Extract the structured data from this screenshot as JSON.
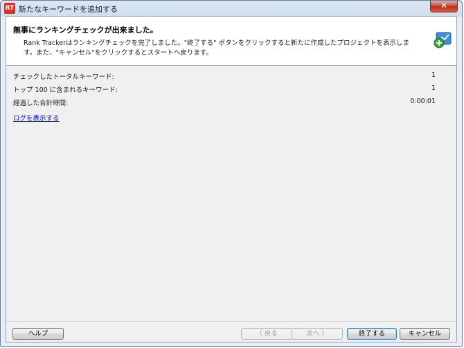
{
  "window": {
    "title": "新たなキーワードを追加する",
    "app_icon_text": "RT",
    "close_glyph": "✕"
  },
  "header": {
    "title": "無事にランキングチェックが出来ました。",
    "description": "Rank Trackerはランキングチェックを完了しました。\"終了する\" ボタンをクリックすると新たに作成したプロジェクトを表示します。また、\"キャンセル\"をクリックするとスタートへ戻ります。",
    "icon": "add-keyword-wizard-icon"
  },
  "stats": [
    {
      "label": "チェックしたトータルキーワード:",
      "value": "1"
    },
    {
      "label": "トップ 100 に含まれるキーワード:",
      "value": "1"
    },
    {
      "label": "経過した合計時間:",
      "value": "0:00:01"
    }
  ],
  "log_link": "ログを表示する",
  "buttons": {
    "help": "ヘルプ",
    "back": "〈 戻る",
    "next": "次へ 〉",
    "finish": "終了する",
    "cancel": "キャンセル"
  }
}
